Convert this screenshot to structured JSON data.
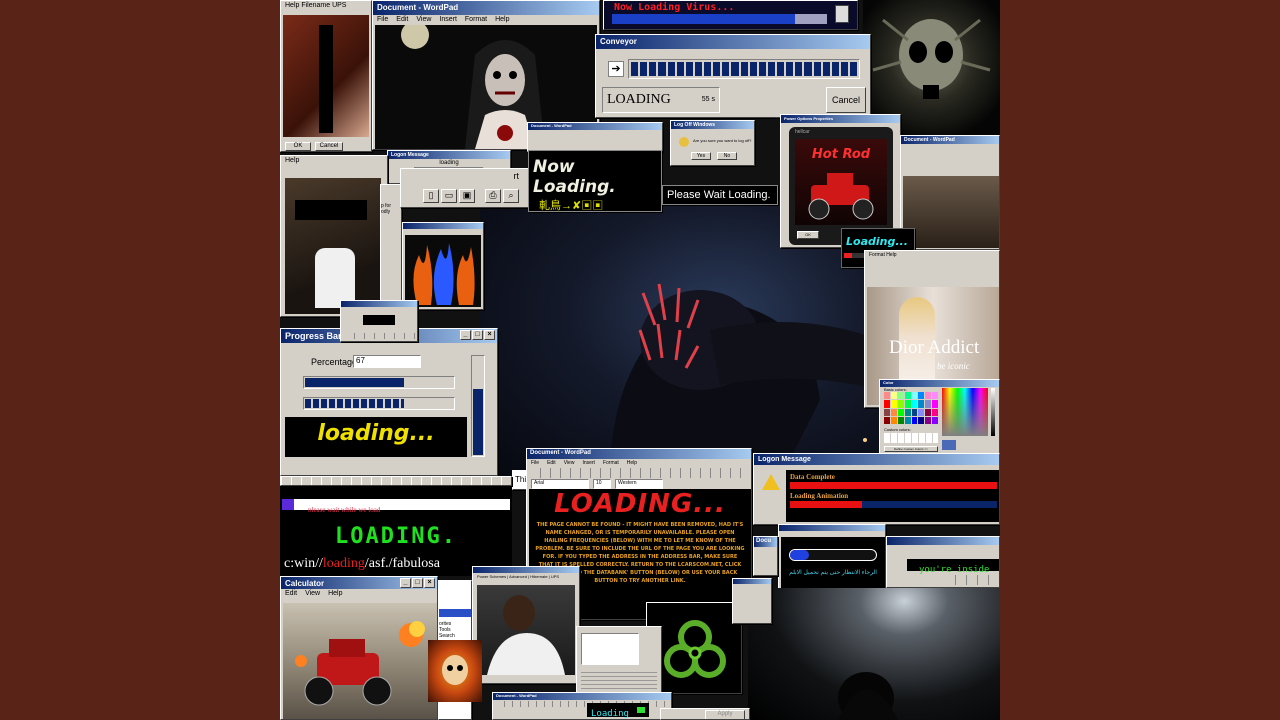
{
  "wordpad_title": "Document - WordPad",
  "wordpad_menu": [
    "File",
    "Edit",
    "View",
    "Insert",
    "Format",
    "Help"
  ],
  "top_left_tabs": "Help  Filename  UPS",
  "top_left_buttons": [
    "OK",
    "Cancel"
  ],
  "virus_title": "Now Loading Virus...",
  "conveyor": {
    "title": "Conveyor",
    "label": "LOADING",
    "seconds": "55 s",
    "cancel": "Cancel"
  },
  "now_loading": {
    "title": "Now Loading.",
    "glyphs": "軋鳥→✘▣▣"
  },
  "please_wait_big": "Please Wait Loading.",
  "logoff": {
    "title": "Log Off Windows",
    "question": "Are you sure you want to log off?",
    "yes": "Yes",
    "no": "No"
  },
  "hot_rod": {
    "title": "Power Options Properties",
    "brand": "hellcar",
    "logo": "Hot Rod",
    "btn_left": "OK",
    "btn_right": "Cancel"
  },
  "loading_cyan": "Loading...",
  "small_loading": {
    "title": "Logon Message",
    "text": "loading",
    "btn": "OK"
  },
  "dior": {
    "brand": "Dior Addict",
    "tag": "be iconic"
  },
  "color_picker": {
    "title": "Color",
    "basic": "Basic colors:",
    "custom": "Custom colors:",
    "define": "Define Custom Colors >>",
    "ok": "OK",
    "cancel": "Cancel",
    "add": "Add to Custom Colors"
  },
  "progress": {
    "title": "Progress Bar D",
    "percentage_label": "Percentage",
    "percentage_value": "67",
    "bar1": 0.67,
    "bar2": 0.67,
    "vertical": 0.67,
    "loading_text": "loading..."
  },
  "please_wait_small": "please wait while we load",
  "loading_green": "LOADING.",
  "url_text_pre": "c:win//",
  "url_text_mid": "loading",
  "url_text_post": "/asf./fabulosa",
  "big_loading": {
    "title": "LOADING...",
    "body": "THE PAGE CANNOT BE FOUND - IT MIGHT HAVE BEEN REMOVED, HAD IT'S NAME CHANGED, OR IS TEMPORARILY UNAVAILABLE. PLEASE OPEN HAILING FREQUENCIES (BELOW) WITH ME TO LET ME KNOW OF THE PROBLEM. BE SURE TO INCLUDE THE URL OF THE PAGE YOU ARE LOOKING FOR. IF YOU TYPED THE ADDRESS IN THE ADDRESS BAR, MAKE SURE THAT IT IS SPELLED CORRECTLY. RETURN TO THE LCARSCOM.NET, CLICK THE 'BACK TO THE DATABANK' BUTTON (BELOW) OR USE YOUR BACK BUTTON TO TRY ANOTHER LINK.",
    "font": "Arial",
    "size": "10",
    "script": "Western"
  },
  "logon": {
    "title": "Logon Message",
    "data_complete": "Data Complete",
    "loading_anim": "Loading Animation",
    "anim_progress": 0.35
  },
  "arabic": "الرجاء الانتظار حتى يتم تحميل الابلم",
  "youre_inside": "you're inside",
  "calculator": {
    "title": "Calculator",
    "menu": [
      "Edit",
      "View",
      "Help"
    ]
  },
  "loading_bottom": "Loading",
  "side_snip": "Thi",
  "side_snip2": "rt",
  "side_snip3": "p for\nodly",
  "ie_snip": [
    "orites",
    "Tools",
    "Search"
  ],
  "doc_short": "Docu",
  "apply": "Apply"
}
